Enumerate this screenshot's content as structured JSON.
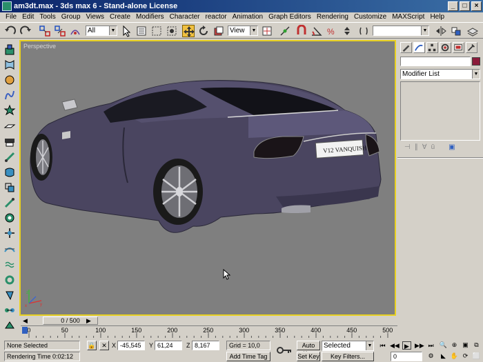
{
  "window": {
    "title": "am3dt.max - 3ds max 6 - Stand-alone License"
  },
  "menu": [
    "File",
    "Edit",
    "Tools",
    "Group",
    "Views",
    "Create",
    "Modifiers",
    "Character",
    "reactor",
    "Animation",
    "Graph Editors",
    "Rendering",
    "Customize",
    "MAXScript",
    "Help"
  ],
  "toolbar": {
    "selection_filter": "All",
    "reference_coord": "View",
    "named_selection": ""
  },
  "viewport": {
    "label": "Perspective",
    "plate_text": "V12 VANQUISH",
    "car_color": "#4a4560",
    "background": "#7f7f7f",
    "border": "#e8d020"
  },
  "command_panel": {
    "object_name": "",
    "object_color": "#8b1a3a",
    "modifier_list": "Modifier List"
  },
  "timeline": {
    "frame_display": "0 / 500",
    "current_frame": 0,
    "total_frames": 500
  },
  "ruler": {
    "ticks": [
      "0",
      "50",
      "100",
      "150",
      "200",
      "250",
      "300",
      "350",
      "400",
      "450",
      "500"
    ]
  },
  "status": {
    "selection": "None Selected",
    "prompt": "Rendering Time  0:02:12",
    "x_label": "X",
    "x_value": "-45,545",
    "y_label": "Y",
    "y_value": "61,24",
    "z_label": "Z",
    "z_value": "8,167",
    "grid": "Grid = 10,0",
    "add_time_tag": "Add Time Tag",
    "auto_key": "Auto Key",
    "set_key": "Set Key",
    "key_mode": "Selected",
    "key_filters": "Key Filters...",
    "frame": "0"
  }
}
